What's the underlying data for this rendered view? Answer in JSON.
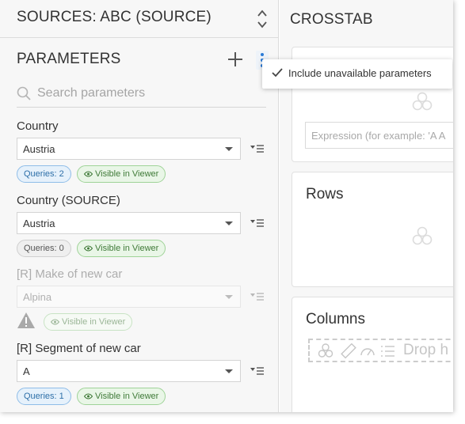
{
  "sources_header": {
    "title": "SOURCES: ABC (SOURCE)"
  },
  "parameters": {
    "title": "PARAMETERS",
    "search_placeholder": "Search parameters",
    "items": [
      {
        "label": "Country",
        "value": "Austria",
        "queries": "Queries: 2",
        "visible": "Visible in Viewer"
      },
      {
        "label": "Country (SOURCE)",
        "value": "Austria",
        "queries": "Queries: 0",
        "visible": "Visible in Viewer"
      },
      {
        "label": "[R] Make of new car",
        "value": "Alpina",
        "visible": "Visible in Viewer"
      },
      {
        "label": "[R] Segment of new car",
        "value": "A",
        "queries": "Queries: 1",
        "visible": "Visible in Viewer"
      }
    ]
  },
  "menu": {
    "include_unavailable": "Include unavailable parameters"
  },
  "crosstab": {
    "title": "CROSSTAB",
    "expression_placeholder": "Expression (for example: 'A A",
    "rows_title": "Rows",
    "columns_title": "Columns",
    "drop_hint": "Drop h"
  },
  "colors": {
    "badge_blue": "#2d6fa8",
    "badge_green": "#3f7a38",
    "accent_kebab": "#2a7ad6"
  },
  "icons": {
    "sort": "sort-updown-icon",
    "add": "plus-icon",
    "more": "kebab-icon",
    "search": "search-icon",
    "filter": "filter-list-icon",
    "eye": "eye-icon",
    "warning": "warning-icon",
    "check": "check-icon",
    "empty": "molecule-icon"
  }
}
